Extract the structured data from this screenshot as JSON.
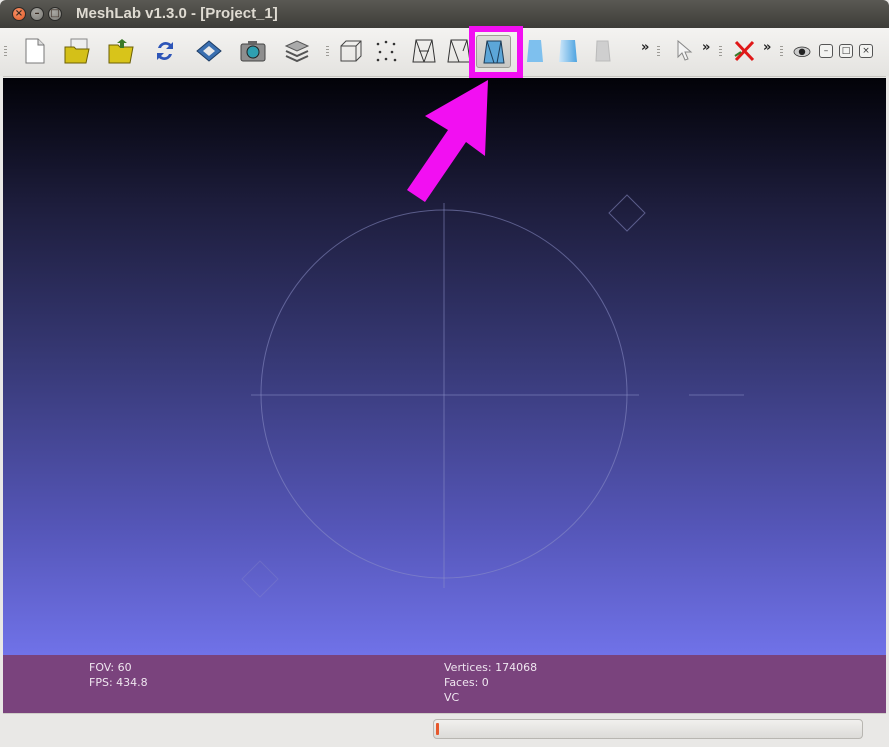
{
  "window": {
    "title": "MeshLab v1.3.0 - [Project_1]",
    "close_glyph": "×",
    "minimize_glyph": "–",
    "maximize_glyph": "□"
  },
  "toolbar": {
    "overflow_glyph": "»",
    "buttons": [
      {
        "icon": "new-document-icon"
      },
      {
        "icon": "open-project-icon"
      },
      {
        "icon": "open-folder-icon"
      },
      {
        "icon": "reload-icon"
      },
      {
        "icon": "save-disk-icon"
      },
      {
        "icon": "snapshot-camera-icon"
      },
      {
        "icon": "layers-icon"
      },
      {
        "icon": "bounding-box-icon"
      },
      {
        "icon": "points-icon"
      },
      {
        "icon": "wireframe-icon"
      },
      {
        "icon": "hidden-lines-icon"
      },
      {
        "icon": "flat-lines-icon",
        "state": "active"
      },
      {
        "icon": "flat-shading-icon"
      },
      {
        "icon": "smooth-shading-icon"
      },
      {
        "icon": "texture-icon"
      },
      {
        "icon": "select-pointer-icon"
      },
      {
        "icon": "delete-red-x-icon"
      },
      {
        "icon": "eye-icon"
      }
    ],
    "highlight_color": "#f20ff2"
  },
  "info": {
    "fov": "FOV: 60",
    "fps": "FPS:   434.8",
    "vertices": "Vertices: 174068",
    "faces": "Faces: 0",
    "vc": "VC"
  },
  "status": {
    "progress": 0.01
  },
  "colors": {
    "info_bar": "#7a437d",
    "annotation_arrow": "#f20ff2",
    "viewport_top": "#020208",
    "viewport_bottom": "#7072e8"
  }
}
